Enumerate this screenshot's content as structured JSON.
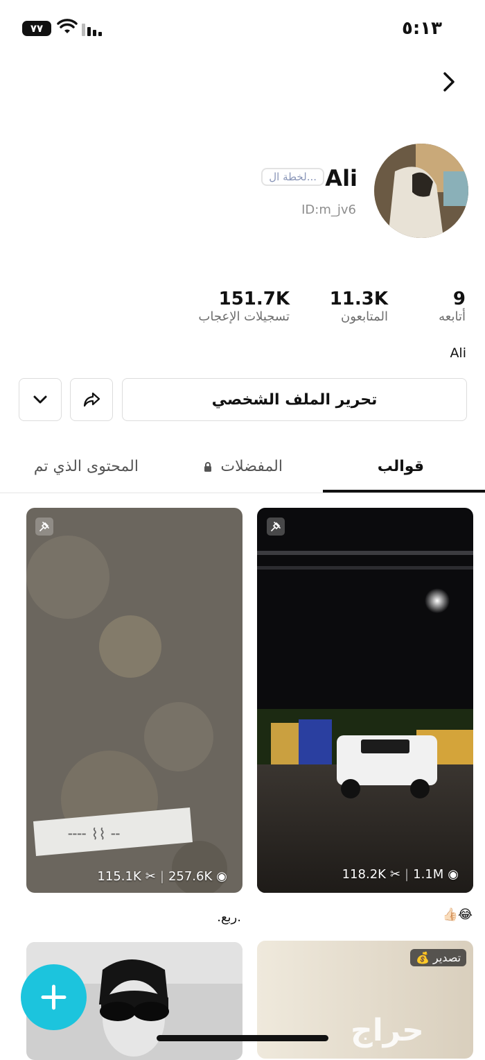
{
  "status_bar": {
    "time": "٥:١٣",
    "battery": "٧٧"
  },
  "profile": {
    "name": "Ali",
    "badge": "لخطة ال...",
    "id": "ID:m_jv6",
    "bio": "Ali"
  },
  "stats": [
    {
      "value": "9",
      "label": "أتابعه"
    },
    {
      "value": "11.3K",
      "label": "المتابعون"
    },
    {
      "value": "151.7K",
      "label": "تسجيلات الإعجاب"
    }
  ],
  "actions": {
    "edit_label": "تحرير الملف الشخصي"
  },
  "tabs": [
    {
      "label": "قوالب"
    },
    {
      "label": "المفضلات"
    },
    {
      "label": "المحتوى الذي تم"
    }
  ],
  "posts": [
    {
      "uses": "118.2K",
      "views": "1.1M",
      "caption": "👍🏻😂"
    },
    {
      "uses": "115.1K",
      "views": "257.6K",
      "caption": ".ربع."
    },
    {
      "badge": "💰 تصدير"
    },
    {}
  ],
  "watermark": "حراج"
}
